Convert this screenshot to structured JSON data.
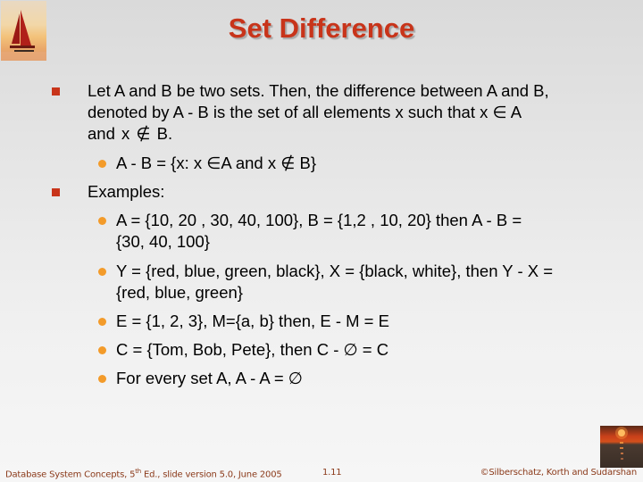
{
  "slide": {
    "title": "Set Difference",
    "bullets": [
      {
        "text": "Let A and B be two sets. Then, the difference between A and B, denoted by A - B is the set of all elements x such that x ∈ A and  x ∉ B.",
        "lines": [
          "Let A and B be two sets. Then, the difference between A and B,",
          "denoted by A - B is the set of all elements x such that x ∈ A",
          "and  x ∉ B."
        ],
        "sub_bullets": [
          {
            "lines": [
              "A - B = {x: x ∈A and x ∉ B}"
            ]
          }
        ]
      },
      {
        "lines": [
          "Examples:"
        ],
        "sub_bullets": [
          {
            "lines": [
              "A = {10, 20 , 30, 40, 100}, B = {1,2 , 10, 20} then A - B =",
              "{30, 40, 100}"
            ]
          },
          {
            "lines": [
              "Y = {red, blue, green, black}, X = {black, white}, then Y - X =",
              "{red, blue, green}"
            ]
          },
          {
            "lines": [
              "E = {1, 2, 3}, M={a, b} then, E - M = E"
            ]
          },
          {
            "lines": [
              "C = {Tom, Bob, Pete}, then C - ∅ = C"
            ]
          },
          {
            "lines": [
              "For every set A, A - A = ∅"
            ]
          }
        ]
      }
    ]
  },
  "footer": {
    "left_prefix": "Database System Concepts, 5",
    "left_sup": "th",
    "left_suffix": " Ed., slide version 5.0, June 2005",
    "page": "1.11",
    "right": "©Silberschatz, Korth and Sudarshan"
  },
  "images": {
    "top_left": "sailboat-sunset-logo",
    "bottom_right": "sunset-over-water-logo"
  },
  "colors": {
    "title": "#c8341a",
    "square_bullet": "#c8341a",
    "round_bullet": "#f39b2a",
    "footer_text": "#8b3a1a"
  }
}
